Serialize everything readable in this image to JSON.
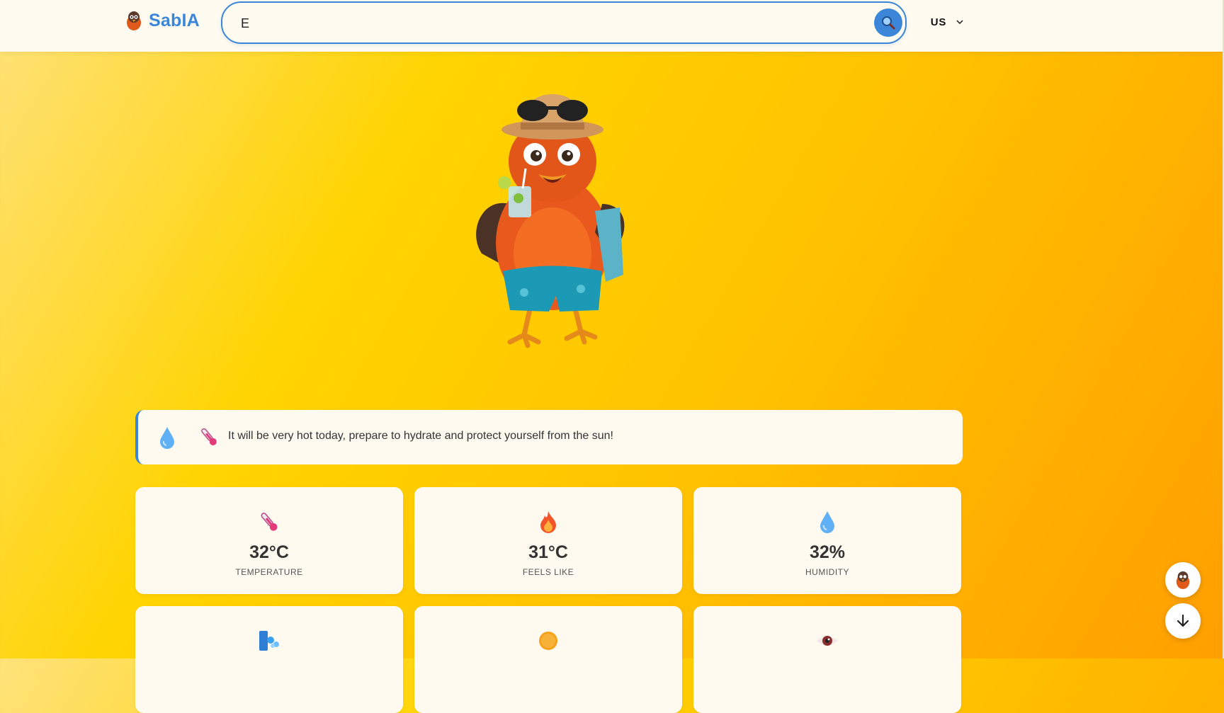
{
  "header": {
    "brand": "SabIA",
    "search": {
      "value": "E",
      "placeholder": ""
    },
    "language": "US"
  },
  "alert": {
    "message": "It will be very hot today, prepare to hydrate and protect yourself from the sun!",
    "icons": [
      "droplet-icon",
      "thermometer-icon"
    ]
  },
  "metrics": [
    {
      "icon": "thermometer-icon",
      "value": "32°C",
      "label": "TEMPERATURE"
    },
    {
      "icon": "flame-icon",
      "value": "31°C",
      "label": "FEELS LIKE"
    },
    {
      "icon": "droplet-icon",
      "value": "32%",
      "label": "HUMIDITY"
    },
    {
      "icon": "wind-icon",
      "value": "",
      "label": ""
    },
    {
      "icon": "sun-icon",
      "value": "",
      "label": ""
    },
    {
      "icon": "eye-icon",
      "value": "",
      "label": ""
    }
  ],
  "floating": {
    "mascot_button": "mascot-chat",
    "scroll_button": "arrow-down-icon"
  },
  "colors": {
    "accent": "#3b86d8",
    "background_start": "#ffe27a",
    "background_end": "#ff9f00"
  }
}
